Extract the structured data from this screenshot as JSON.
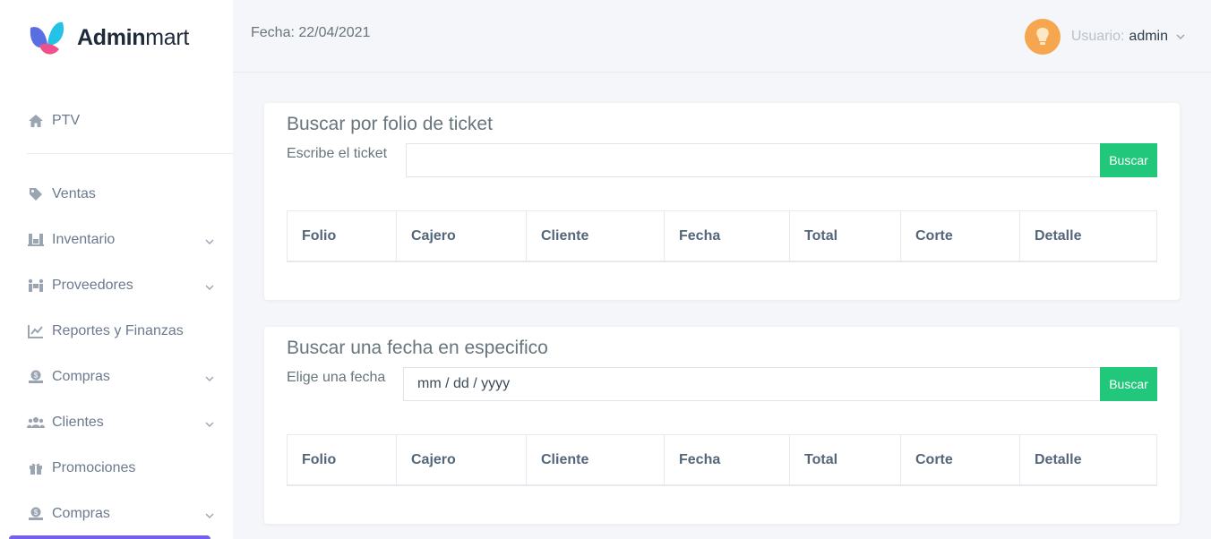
{
  "brand": {
    "name_bold": "Admin",
    "name_light": "mart"
  },
  "header": {
    "date": "Fecha: 22/04/2021",
    "user_label": "Usuario:",
    "user_name": "admin"
  },
  "sidebar": {
    "items": [
      {
        "label": "PTV",
        "icon": "home-icon"
      },
      {
        "label": "Ventas",
        "icon": "tag-icon"
      },
      {
        "label": "Inventario",
        "icon": "warehouse-icon",
        "expandable": true
      },
      {
        "label": "Proveedores",
        "icon": "people-carry-icon",
        "expandable": true
      },
      {
        "label": "Reportes y Finanzas",
        "icon": "chart-line-icon"
      },
      {
        "label": "Compras",
        "icon": "money-icon",
        "expandable": true
      },
      {
        "label": "Clientes",
        "icon": "users-icon",
        "expandable": true
      },
      {
        "label": "Promociones",
        "icon": "gift-icon"
      },
      {
        "label": "Compras",
        "icon": "money-icon",
        "expandable": true
      }
    ]
  },
  "ticket_search": {
    "title": "Buscar por folio de ticket",
    "label": "Escribe el ticket",
    "value": "",
    "button": "Buscar"
  },
  "date_search": {
    "title": "Buscar una fecha en especifico",
    "label": "Elige una fecha",
    "value": "mm / dd / yyyy",
    "button": "Buscar"
  },
  "table_headers": [
    "Folio",
    "Cajero",
    "Cliente",
    "Fecha",
    "Total",
    "Corte",
    "Detalle"
  ],
  "colors": {
    "accent_green": "#21c77a",
    "avatar": "#f5a64f",
    "scroll_accent": "#7460ee"
  }
}
